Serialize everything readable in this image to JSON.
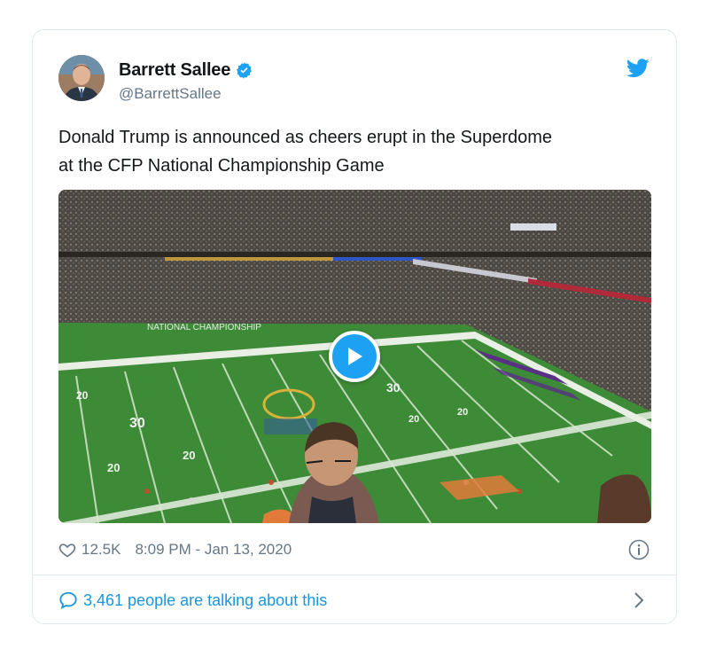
{
  "tweet": {
    "author": {
      "display_name": "Barrett Sallee",
      "handle": "@BarrettSallee",
      "verified": true
    },
    "text_line1": "Donald Trump is announced as cheers erupt in the Superdome",
    "text_line2": "at the CFP National Championship Game",
    "likes": "12.5K",
    "timestamp": "8:09 PM - Jan 13, 2020",
    "conversation_text": "3,461 people are talking about this"
  },
  "media": {
    "type": "video",
    "field_numbers": [
      "20",
      "30",
      "20",
      "20",
      "30",
      "20",
      "20"
    ],
    "banner_text": "NATIONAL CHAMPIONSHIP"
  },
  "icons": {
    "verified": "verified-badge-icon",
    "brand": "twitter-bird-icon",
    "play": "play-icon",
    "like": "heart-icon",
    "info": "info-icon",
    "reply": "speech-bubble-icon",
    "more": "chevron-right-icon"
  },
  "colors": {
    "accent": "#1da1f2",
    "link": "#1b95e0",
    "text": "#14171a",
    "muted": "#657786",
    "border": "#e1e8ed"
  }
}
